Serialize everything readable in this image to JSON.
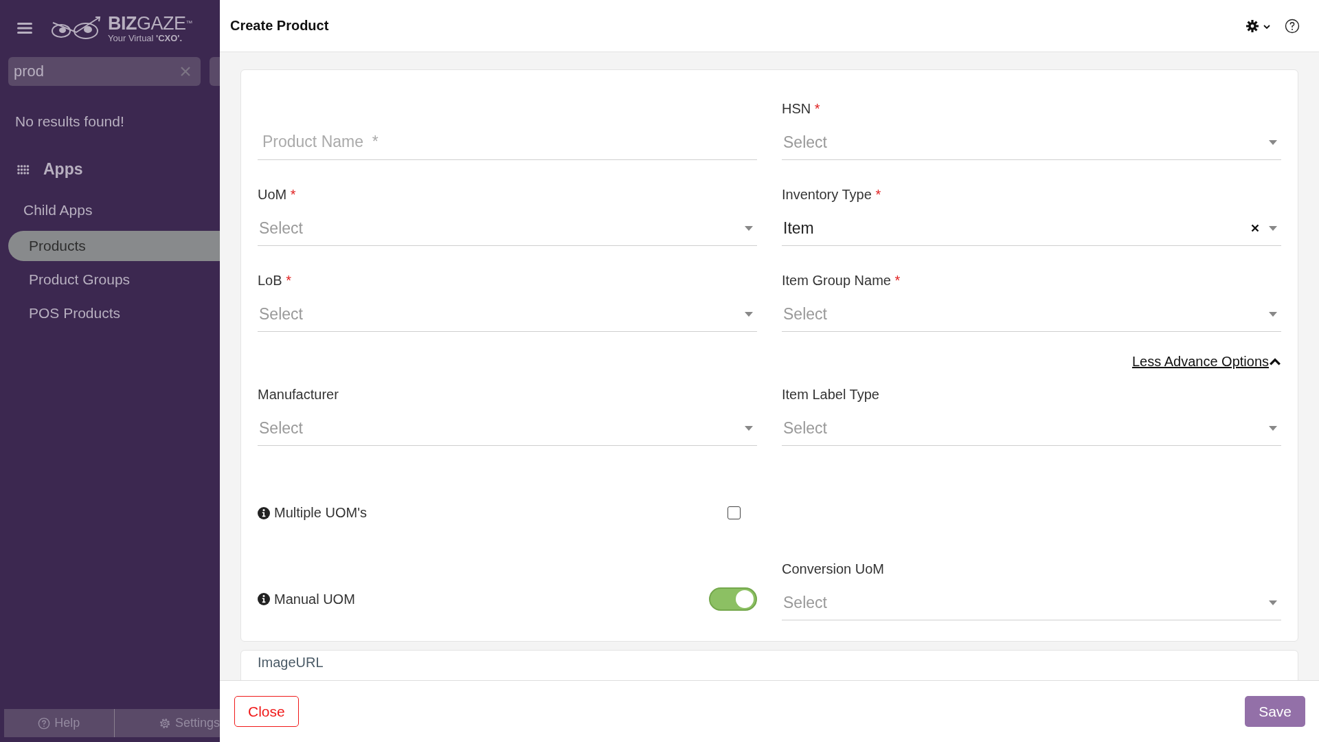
{
  "sidebar": {
    "brand": {
      "bold": "BIZ",
      "name": "GAZE",
      "mark": "™",
      "tagline": "Your Virtual **'CXO'.**"
    },
    "search": {
      "value": "prod"
    },
    "message": "No results found!",
    "section": "Apps",
    "items": [
      {
        "label": "Child Apps",
        "selected": false,
        "children": [
          {
            "label": "Products",
            "selected": true
          },
          {
            "label": "Product Groups",
            "selected": false
          },
          {
            "label": "POS Products",
            "selected": false
          }
        ]
      }
    ],
    "footer": [
      {
        "label": "Help",
        "kind": "help"
      },
      {
        "label": "Settings",
        "kind": "settings"
      }
    ]
  },
  "header": {
    "title": "Create Product"
  },
  "form": {
    "rows": [
      {
        "left": {
          "kind": "text",
          "placeholder": "Product Name  *"
        },
        "right": {
          "kind": "select",
          "label": "HSN",
          "required": "*",
          "placeholder": "Select"
        }
      },
      {
        "left": {
          "kind": "select",
          "label": "UoM",
          "required": "*",
          "placeholder": "Select"
        },
        "right": {
          "kind": "select",
          "label": "Inventory Type",
          "required": "*",
          "value": "Item"
        }
      },
      {
        "left": {
          "kind": "select",
          "label": "LoB",
          "required": "*",
          "placeholder": "Select"
        },
        "right": {
          "kind": "select",
          "label": "Item Group Name",
          "required": "*",
          "placeholder": "Select"
        }
      },
      {
        "right": {
          "kind": "link",
          "text": "Less Advance Options",
          "expanded": true
        }
      },
      {
        "left": {
          "kind": "select",
          "label": "Manufacturer",
          "placeholder": "Select"
        },
        "right": {
          "kind": "select",
          "label": "Item Label Type",
          "placeholder": "Select"
        }
      },
      {
        "left": {
          "kind": "checkbox",
          "label": "Multiple UOM's",
          "checked": false
        }
      },
      {
        "left": {
          "kind": "toggle",
          "label": "Manual UOM",
          "on": true
        },
        "right": {
          "kind": "select",
          "label": "Conversion UoM",
          "placeholder": "Select"
        }
      }
    ]
  },
  "next_section": {
    "label": "ImageURL"
  },
  "footer": {
    "close": "Close",
    "save": "Save"
  }
}
